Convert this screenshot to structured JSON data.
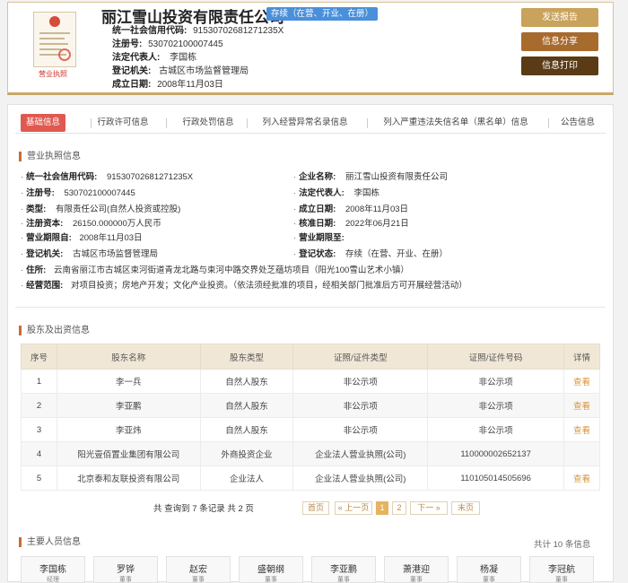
{
  "header": {
    "license_label": "营业执照",
    "company_name": "丽江雪山投资有限责任公司",
    "status_badge": "存续（在营、开业、在册）",
    "rows": [
      {
        "k": "统一社会信用代码:",
        "v": "91530702681271235X"
      },
      {
        "k": "注册号:",
        "v": "530702100007445"
      },
      {
        "k": "法定代表人:",
        "v": "李国栋"
      },
      {
        "k": "登记机关:",
        "v": "古城区市场监督管理局"
      },
      {
        "k": "成立日期:",
        "v": "2008年11月03日"
      }
    ],
    "buttons": {
      "send_report": "发送报告",
      "share": "信息分享",
      "print": "信息打印"
    },
    "button_colors": {
      "send_report": "#c9a25b",
      "share": "#a86b2e",
      "print": "#5a3b16"
    }
  },
  "tabs": [
    "基础信息",
    "行政许可信息",
    "行政处罚信息",
    "列入经营异常名录信息",
    "列入严重违法失信名单（黑名单）信息",
    "公告信息"
  ],
  "license_section": {
    "title": "营业执照信息",
    "left": [
      {
        "k": "统一社会信用代码:",
        "v": "91530702681271235X"
      },
      {
        "k": "注册号:",
        "v": "530702100007445"
      },
      {
        "k": "类型:",
        "v": "有限责任公司(自然人投资或控股)"
      },
      {
        "k": "注册资本:",
        "v": "26150.000000万人民币"
      },
      {
        "k": "营业期限自:",
        "v": "2008年11月03日"
      },
      {
        "k": "登记机关:",
        "v": "古城区市场监督管理局"
      }
    ],
    "right": [
      {
        "k": "企业名称:",
        "v": "丽江雪山投资有限责任公司"
      },
      {
        "k": "法定代表人:",
        "v": "李国栋"
      },
      {
        "k": "成立日期:",
        "v": "2008年11月03日"
      },
      {
        "k": "核准日期:",
        "v": "2022年06月21日"
      },
      {
        "k": "营业期限至:",
        "v": ""
      },
      {
        "k": "登记状态:",
        "v": "存续（在营、开业、在册）"
      }
    ],
    "address": {
      "k": "住所:",
      "v": "云南省丽江市古城区束河街道青龙北路与束河中路交界处芝蕴坊项目（阳光100雪山艺术小镇）"
    },
    "scope": {
      "k": "经营范围:",
      "v": "对项目投资；房地产开发；文化产业投资。（依法须经批准的项目，经相关部门批准后方可开展经营活动）"
    }
  },
  "shareholders": {
    "title": "股东及出资信息",
    "columns": [
      "序号",
      "股东名称",
      "股东类型",
      "证照/证件类型",
      "证照/证件号码",
      "详情"
    ],
    "rows": [
      {
        "no": "1",
        "name": "李一兵",
        "type": "自然人股东",
        "id_type": "非公示项",
        "id_no": "非公示项",
        "detail": "查看"
      },
      {
        "no": "2",
        "name": "李亚鹏",
        "type": "自然人股东",
        "id_type": "非公示项",
        "id_no": "非公示项",
        "detail": "查看"
      },
      {
        "no": "3",
        "name": "李亚炜",
        "type": "自然人股东",
        "id_type": "非公示项",
        "id_no": "非公示项",
        "detail": "查看"
      },
      {
        "no": "4",
        "name": "阳光壹佰置业集团有限公司",
        "type": "外商投资企业",
        "id_type": "企业法人营业执照(公司)",
        "id_no": "110000002652137",
        "detail": ""
      },
      {
        "no": "5",
        "name": "北京泰和友联投资有限公司",
        "type": "企业法人",
        "id_type": "企业法人营业执照(公司)",
        "id_no": "110105014505696",
        "detail": "查看"
      }
    ],
    "pager": {
      "summary": "共 查询到 7 条记录 共 2 页",
      "first": "首页",
      "prev": "« 上一页",
      "pages": [
        "1",
        "2"
      ],
      "next": "下一 »",
      "last": "末页"
    }
  },
  "personnel": {
    "title": "主要人员信息",
    "count": "共计 10 条信息",
    "people": [
      {
        "name": "李国栋",
        "role": "经理"
      },
      {
        "name": "罗铧",
        "role": "董事"
      },
      {
        "name": "赵宏",
        "role": "董事"
      },
      {
        "name": "盛朝纲",
        "role": "董事"
      },
      {
        "name": "李亚鹏",
        "role": "董事"
      },
      {
        "name": "萧港迎",
        "role": "董事"
      },
      {
        "name": "杨凝",
        "role": "董事"
      },
      {
        "name": "李冠航",
        "role": "董事"
      }
    ]
  }
}
